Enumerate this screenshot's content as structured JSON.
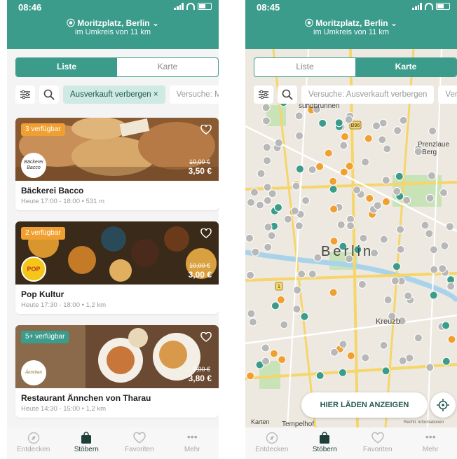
{
  "left_screen": {
    "status_time": "08:46",
    "location": "Moritzplatz, Berlin",
    "radius": "im Umkreis von 11 km",
    "tabs": {
      "list": "Liste",
      "map": "Karte"
    },
    "filters": {
      "active_chip": "Ausverkauft verbergen",
      "active_chip_close": "×",
      "next_chip": "Versuche: Ma"
    },
    "cards": [
      {
        "badge": "3 verfügbar",
        "badge_color": "#f0a030",
        "logo_text": "Bäckerei Bacco",
        "old_price": "10,00 €",
        "price": "3,50 €",
        "name": "Bäckerei Bacco",
        "time": "Heute 17:00 - 18:00 • 531 m"
      },
      {
        "badge": "2 verfügbar",
        "badge_color": "#f0a030",
        "logo_text": "POP",
        "old_price": "10,00 €",
        "price": "3,00 €",
        "name": "Pop Kultur",
        "time": "Heute 17:30 - 18:00 • 1,2 km"
      },
      {
        "badge": "5+ verfügbar",
        "badge_color": "#3c9c8c",
        "logo_text": "Ännchen",
        "old_price": "7,00 €",
        "price": "3,80 €",
        "name": "Restaurant Ännchen von Tharau",
        "time": "Heute 14:30 - 15:00 • 1,2 km"
      }
    ]
  },
  "right_screen": {
    "status_time": "08:45",
    "location": "Moritzplatz, Berlin",
    "radius": "im Umkreis von 11 km",
    "tabs": {
      "list": "Liste",
      "map": "Karte"
    },
    "filters": {
      "chip1": "Versuche: Ausverkauft verbergen",
      "chip2": "Vers"
    },
    "map_labels": {
      "city": "Berlin",
      "kreuzberg": "Kreuzb",
      "prenzlauer": "Prenzlaue",
      "prenzlauer2": "Berg",
      "gesundbrunnen": "sundbrunnen",
      "tempelhof": "Tempelhof",
      "attribution": "Karten",
      "legal": "Rechtl. Informationen",
      "road_b96": "B96",
      "road_1": "1"
    },
    "cta": "HIER LÄDEN ANZEIGEN"
  },
  "tabbar": [
    {
      "label": "Entdecken",
      "icon": "compass-icon"
    },
    {
      "label": "Stöbern",
      "icon": "shopping-bag-icon"
    },
    {
      "label": "Favoriten",
      "icon": "heart-icon"
    },
    {
      "label": "Mehr",
      "icon": "more-icon"
    }
  ],
  "colors": {
    "brand": "#3c9c8c",
    "orange": "#f0a030",
    "map_bg": "#ede9e0"
  }
}
